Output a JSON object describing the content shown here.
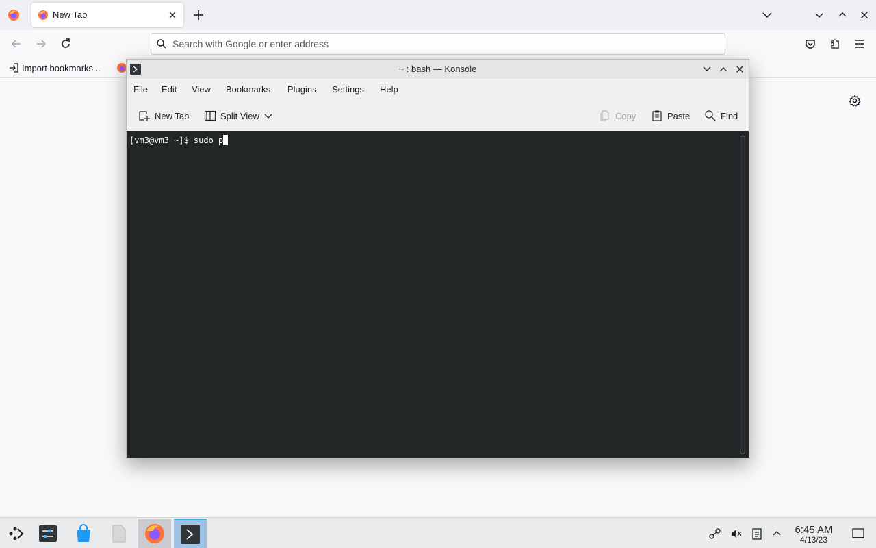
{
  "firefox": {
    "tab": {
      "title": "New Tab"
    },
    "urlbar": {
      "placeholder": "Search with Google or enter address"
    },
    "bookmarks": {
      "import_label": "Import bookmarks..."
    }
  },
  "konsole": {
    "title": "~ : bash — Konsole",
    "menu": [
      "File",
      "Edit",
      "View",
      "Bookmarks",
      "Plugins",
      "Settings",
      "Help"
    ],
    "toolbar": {
      "new_tab": "New Tab",
      "split_view": "Split View",
      "copy": "Copy",
      "paste": "Paste",
      "find": "Find"
    },
    "terminal": {
      "prompt": "[vm3@vm3 ~]$ ",
      "input": "sudo p"
    }
  },
  "panel": {
    "clock": {
      "time": "6:45 AM",
      "date": "4/13/23"
    }
  },
  "colors": {
    "terminal_bg": "#232627",
    "firefox_orange": "#ff7139",
    "kde_accent": "#3daee9"
  }
}
